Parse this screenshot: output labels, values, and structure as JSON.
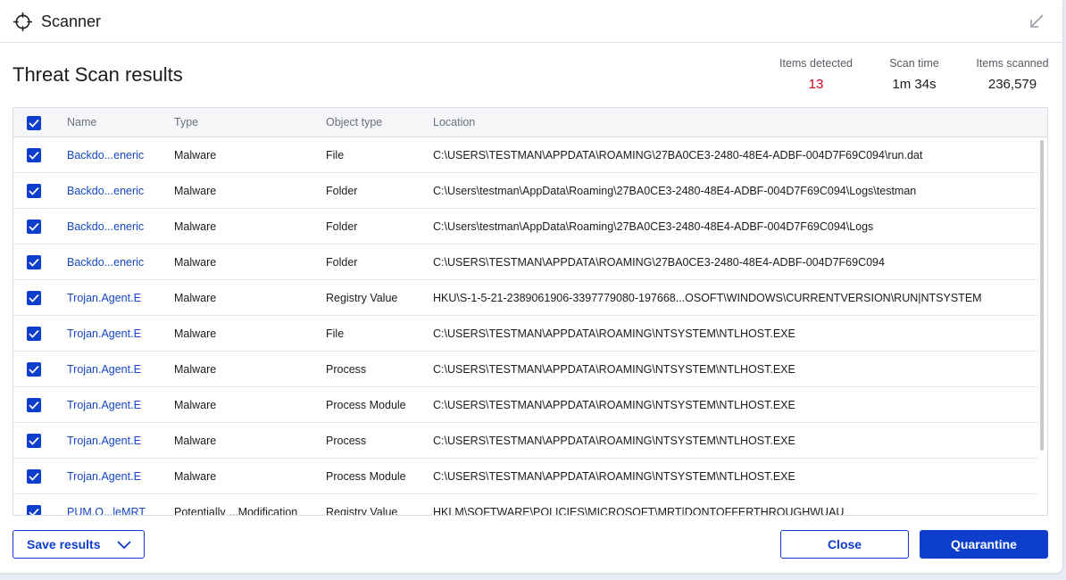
{
  "app": {
    "title": "Scanner"
  },
  "page": {
    "title": "Threat Scan results"
  },
  "stats": {
    "items_detected": {
      "label": "Items detected",
      "value": "13"
    },
    "scan_time": {
      "label": "Scan time",
      "value": "1m 34s"
    },
    "items_scanned": {
      "label": "Items scanned",
      "value": "236,579"
    }
  },
  "table": {
    "columns": [
      "Name",
      "Type",
      "Object type",
      "Location"
    ],
    "rows": [
      {
        "name": "Backdo...eneric",
        "type": "Malware",
        "object_type": "File",
        "location": "C:\\USERS\\TESTMAN\\APPDATA\\ROAMING\\27BA0CE3-2480-48E4-ADBF-004D7F69C094\\run.dat"
      },
      {
        "name": "Backdo...eneric",
        "type": "Malware",
        "object_type": "Folder",
        "location": "C:\\Users\\testman\\AppData\\Roaming\\27BA0CE3-2480-48E4-ADBF-004D7F69C094\\Logs\\testman"
      },
      {
        "name": "Backdo...eneric",
        "type": "Malware",
        "object_type": "Folder",
        "location": "C:\\Users\\testman\\AppData\\Roaming\\27BA0CE3-2480-48E4-ADBF-004D7F69C094\\Logs"
      },
      {
        "name": "Backdo...eneric",
        "type": "Malware",
        "object_type": "Folder",
        "location": "C:\\USERS\\TESTMAN\\APPDATA\\ROAMING\\27BA0CE3-2480-48E4-ADBF-004D7F69C094"
      },
      {
        "name": "Trojan.Agent.E",
        "type": "Malware",
        "object_type": "Registry Value",
        "location": "HKU\\S-1-5-21-2389061906-3397779080-197668...OSOFT\\WINDOWS\\CURRENTVERSION\\RUN|NTSYSTEM"
      },
      {
        "name": "Trojan.Agent.E",
        "type": "Malware",
        "object_type": "File",
        "location": "C:\\USERS\\TESTMAN\\APPDATA\\ROAMING\\NTSYSTEM\\NTLHOST.EXE"
      },
      {
        "name": "Trojan.Agent.E",
        "type": "Malware",
        "object_type": "Process",
        "location": "C:\\USERS\\TESTMAN\\APPDATA\\ROAMING\\NTSYSTEM\\NTLHOST.EXE"
      },
      {
        "name": "Trojan.Agent.E",
        "type": "Malware",
        "object_type": "Process Module",
        "location": "C:\\USERS\\TESTMAN\\APPDATA\\ROAMING\\NTSYSTEM\\NTLHOST.EXE"
      },
      {
        "name": "Trojan.Agent.E",
        "type": "Malware",
        "object_type": "Process",
        "location": "C:\\USERS\\TESTMAN\\APPDATA\\ROAMING\\NTSYSTEM\\NTLHOST.EXE"
      },
      {
        "name": "Trojan.Agent.E",
        "type": "Malware",
        "object_type": "Process Module",
        "location": "C:\\USERS\\TESTMAN\\APPDATA\\ROAMING\\NTSYSTEM\\NTLHOST.EXE"
      },
      {
        "name": "PUM.O...leMRT",
        "type": "Potentially ...Modification",
        "object_type": "Registry Value",
        "location": "HKLM\\SOFTWARE\\POLICIES\\MICROSOFT\\MRT|DONTOFFERTHROUGHWUAU"
      }
    ]
  },
  "buttons": {
    "save": "Save results",
    "close": "Close",
    "quarantine": "Quarantine"
  },
  "colors": {
    "accent": "#0d3ecc",
    "link": "#1546c3",
    "detected": "#d0021b"
  }
}
